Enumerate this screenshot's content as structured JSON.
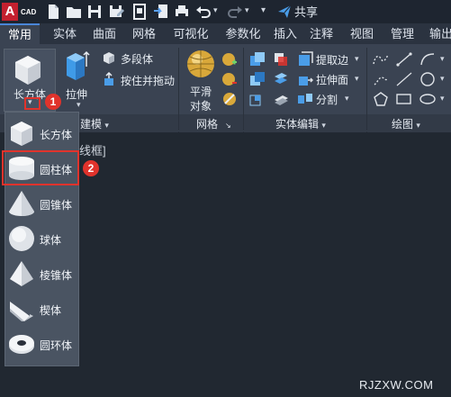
{
  "app": {
    "logo_letter": "A",
    "logo_text": "CAD",
    "share_label": "共享"
  },
  "tabs": [
    "常用",
    "实体",
    "曲面",
    "网格",
    "可视化",
    "参数化",
    "插入",
    "注释",
    "视图",
    "管理",
    "输出"
  ],
  "ribbon": {
    "box_label": "长方体",
    "extrude_label": "拉伸",
    "polysolid_label": "多段体",
    "presspull_label": "按住并拖动",
    "smooth_label_1": "平滑",
    "smooth_label_2": "对象",
    "extract_edges_label": "提取边",
    "extrude_face_label": "拉伸面",
    "separate_label": "分割",
    "panel_modeling_partial": "建模",
    "panel_mesh": "网格",
    "panel_solid_edit": "实体编辑",
    "panel_draw": "绘图"
  },
  "dropdown": {
    "items": [
      "长方体",
      "圆柱体",
      "圆锥体",
      "球体",
      "棱锥体",
      "楔体",
      "圆环体"
    ]
  },
  "canvas": {
    "partial_text": "线框]"
  },
  "callouts": {
    "one": "1",
    "two": "2"
  },
  "watermark": "RJZXW.COM",
  "colors": {
    "highlight": "#e0332c",
    "accent": "#4a86d8"
  }
}
